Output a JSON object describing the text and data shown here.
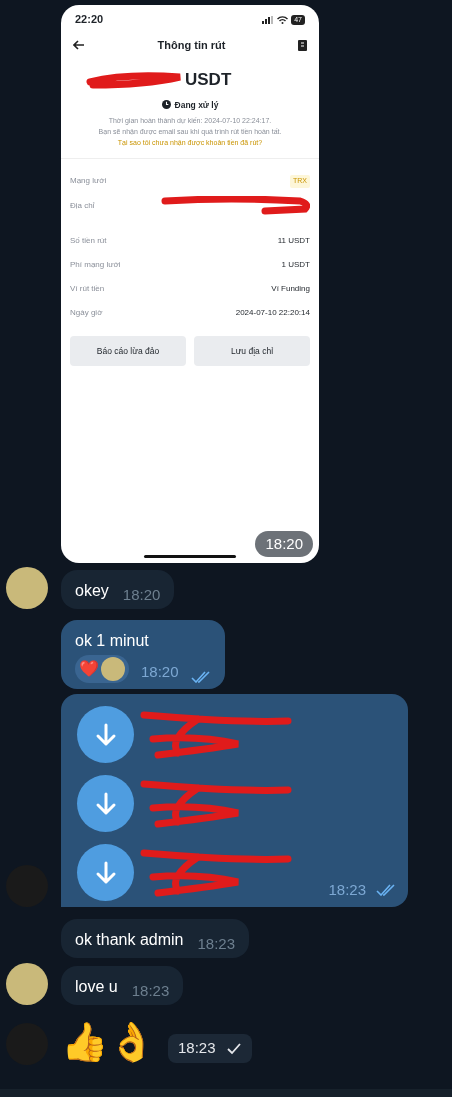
{
  "messages": [
    {
      "kind": "photo",
      "time": "18:20",
      "phone": {
        "status_time": "22:20",
        "battery": "47",
        "title": "Thông tin rút",
        "amount_unit": "USDT",
        "status": "Đang xử lý",
        "note_lines": [
          "Thời gian hoàn thành dự kiến: 2024-07-10 22:24:17.",
          "Bạn sẽ nhận được email sau khi quá trình rút tiền hoàn tất."
        ],
        "link": "Tại sao tôi chưa nhận được khoản tiền đã rút?",
        "rows": [
          {
            "kind": "badge",
            "label": "Mạng lưới",
            "value": "TRX"
          },
          {
            "kind": "redacted",
            "label": "Địa chỉ"
          },
          {
            "kind": "text",
            "label": "Số tiền rút",
            "value": "11 USDT"
          },
          {
            "kind": "text",
            "label": "Phí mạng lưới",
            "value": "1 USDT"
          },
          {
            "kind": "text",
            "label": "Ví rút tiền",
            "value": "Ví Funding"
          },
          {
            "kind": "text",
            "label": "Ngày giờ",
            "value": "2024-07-10 22:20:14"
          }
        ],
        "buttons": [
          "Báo cáo lừa đảo",
          "Lưu địa chỉ"
        ]
      }
    },
    {
      "kind": "text",
      "outgoing": false,
      "text": "okey",
      "time": "18:20",
      "avatar": {
        "color": "#c9b97a"
      }
    },
    {
      "kind": "text",
      "outgoing": true,
      "text": "ok 1 minut",
      "time": "18:20",
      "read": true,
      "reactions": [
        "❤️"
      ]
    },
    {
      "kind": "files",
      "outgoing": true,
      "files": [
        {
          "kind": "redacted"
        },
        {
          "kind": "redacted"
        },
        {
          "kind": "redacted"
        }
      ],
      "time": "18:23",
      "read": true,
      "avatar": {
        "color": "#1a1a1a"
      }
    },
    {
      "kind": "text",
      "outgoing": false,
      "text": "ok thank admin",
      "time": "18:23"
    },
    {
      "kind": "text",
      "outgoing": false,
      "text": "love u",
      "time": "18:23",
      "avatar": {
        "color": "#c9b97a"
      }
    },
    {
      "kind": "emoji",
      "outgoing": true,
      "text": "👍👌",
      "time": "18:23",
      "read": false,
      "avatar": {
        "color": "#1a1a1a"
      }
    }
  ]
}
